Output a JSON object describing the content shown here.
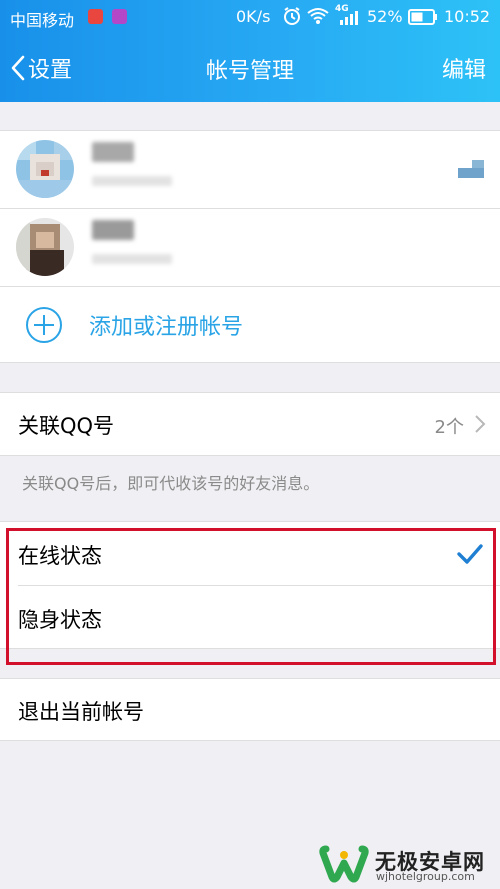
{
  "status_bar": {
    "carrier": "中国移动",
    "speed": "0K/s",
    "network": "4G",
    "battery": "52%",
    "time": "10:52"
  },
  "nav": {
    "back_label": "设置",
    "title": "帐号管理",
    "edit_label": "编辑"
  },
  "accounts": {
    "add_label": "添加或注册帐号"
  },
  "linked": {
    "label": "关联QQ号",
    "count": "2个",
    "hint": "关联QQ号后，即可代收该号的好友消息。"
  },
  "status_options": {
    "online_label": "在线状态",
    "online_selected": true,
    "invisible_label": "隐身状态"
  },
  "logout": {
    "label": "退出当前帐号"
  },
  "watermark": {
    "name": "无极安卓网",
    "url": "wjhotelgroup.com"
  },
  "colors": {
    "header_start": "#1890ea",
    "header_end": "#2dc2f7",
    "accent": "#2aa4e6",
    "highlight_frame": "#d3102c"
  }
}
